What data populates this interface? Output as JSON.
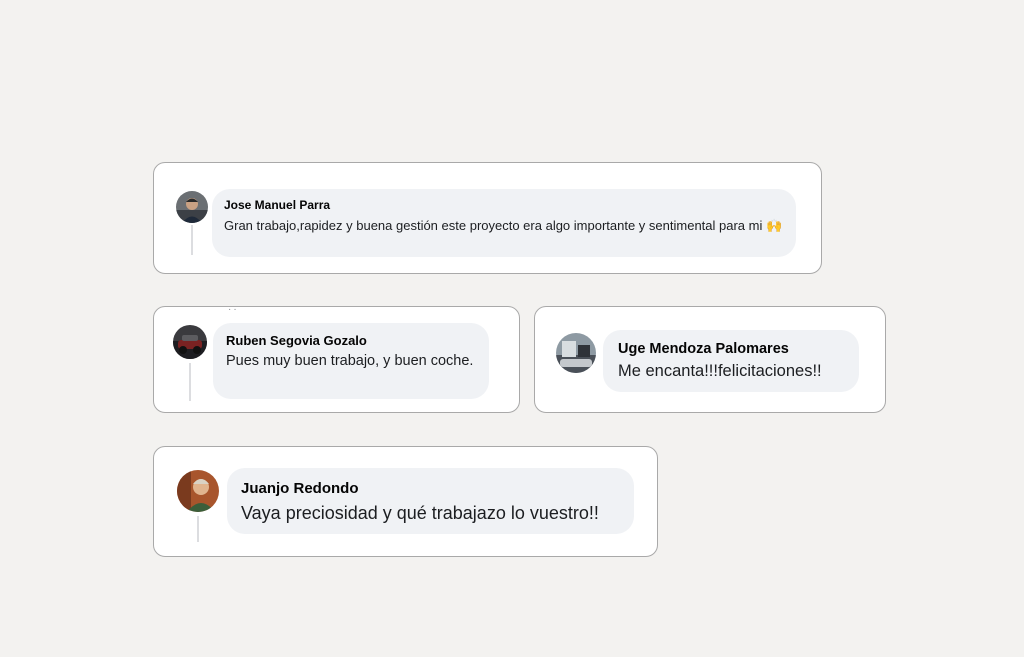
{
  "comments": [
    {
      "author": "Jose Manuel Parra",
      "text": "Gran trabajo,rapidez y buena gestión este proyecto era algo importante y sentimental para mi 🙌"
    },
    {
      "author": "Ruben Segovia Gozalo",
      "text": "Pues muy buen trabajo, y buen coche."
    },
    {
      "author": "Uge Mendoza Palomares",
      "text": "Me encanta!!!felicitaciones!!"
    },
    {
      "author": "Juanjo Redondo",
      "text": "Vaya preciosidad y qué trabajazo lo vuestro!!"
    }
  ],
  "colors": {
    "page_background": "#f3f2f0",
    "card_border": "#a9a9a9",
    "bubble_background": "#f0f2f5",
    "text": "#1c1e21"
  },
  "icons": [
    "avatar-photo-icon"
  ]
}
